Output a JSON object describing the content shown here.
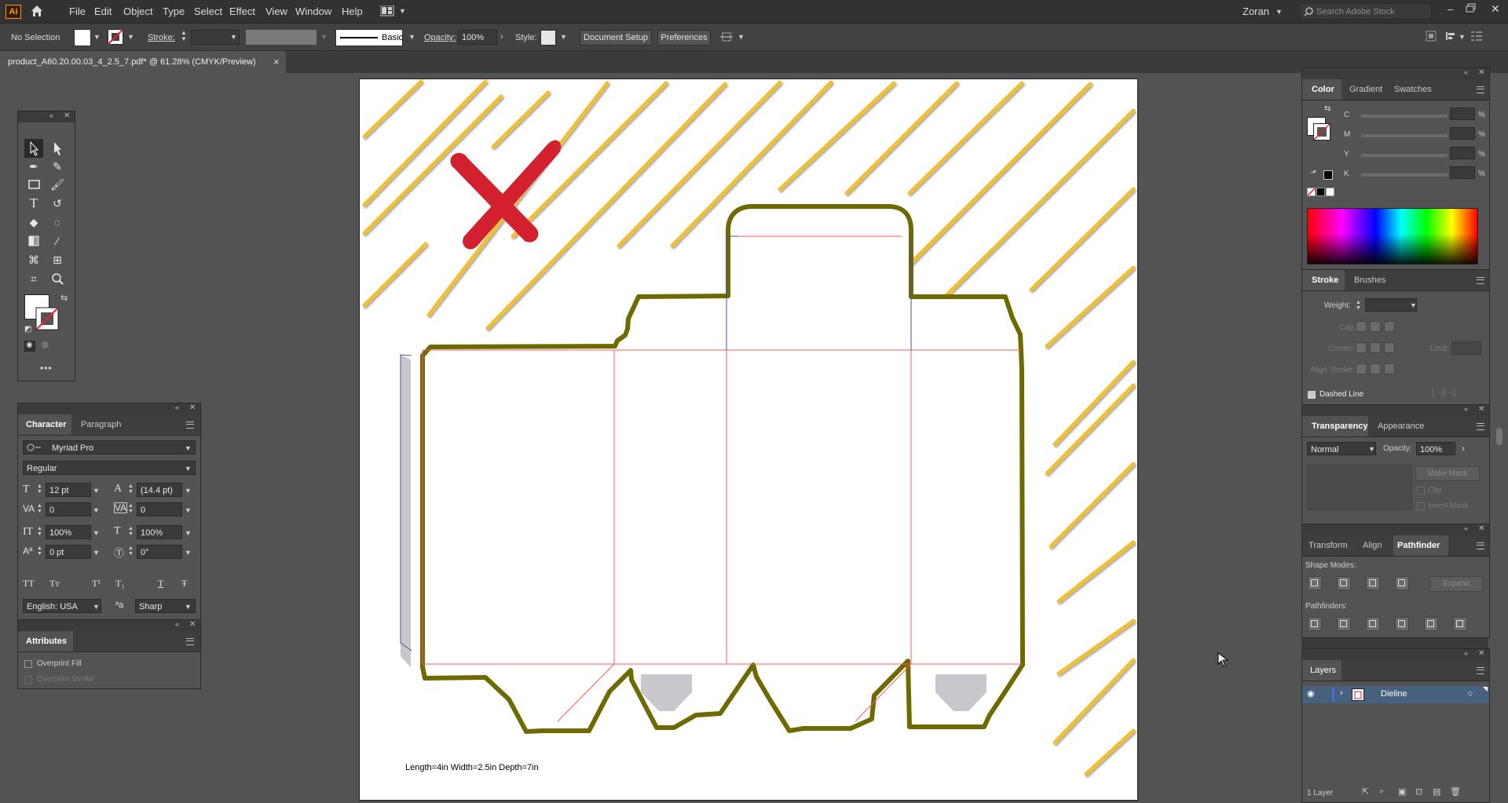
{
  "app": {
    "logo": "Ai",
    "user": "Zoran",
    "search_placeholder": "Search Adobe Stock"
  },
  "menu": [
    "File",
    "Edit",
    "Object",
    "Type",
    "Select",
    "Effect",
    "View",
    "Window",
    "Help"
  ],
  "control": {
    "selection": "No Selection",
    "stroke_label": "Stroke:",
    "brush": "Basic",
    "opacity_label": "Opacity:",
    "opacity": "100%",
    "style_label": "Style:",
    "doc_setup": "Document Setup",
    "preferences": "Preferences"
  },
  "document_tab": {
    "title": "product_A60.20.00.03_4_2.5_7.pdf* @ 61.28% (CMYK/Preview)",
    "close": "×"
  },
  "artboard": {
    "caption": "Length=4in Width=2.5in Depth=7in"
  },
  "character": {
    "tabs": [
      "Character",
      "Paragraph"
    ],
    "font": "Myriad Pro",
    "style": "Regular",
    "size": "12 pt",
    "leading": "(14.4 pt)",
    "kerning": "0",
    "tracking": "0",
    "vscale": "100%",
    "hscale": "100%",
    "baseline": "0 pt",
    "rotation": "0°",
    "case_buttons": [
      "TT",
      "Tт",
      "T¹",
      "T₁",
      "T",
      "Ŧ"
    ],
    "language": "English: USA",
    "aa_icon": "ªa",
    "antialias": "Sharp"
  },
  "attributes": {
    "title": "Attributes",
    "overprint_fill": "Overprint Fill",
    "overprint_stroke": "Overprint Stroke"
  },
  "color": {
    "tabs": [
      "Color",
      "Gradient",
      "Swatches"
    ],
    "channels": [
      "C",
      "M",
      "Y",
      "K"
    ],
    "pct": "%"
  },
  "stroke": {
    "tabs": [
      "Stroke",
      "Brushes"
    ],
    "weight": "Weight:",
    "cap": "Cap:",
    "corner": "Corner:",
    "limit": "Limit:",
    "align": "Align Stroke:",
    "dashed": "Dashed Line"
  },
  "transparency": {
    "tabs": [
      "Transparency",
      "Appearance"
    ],
    "mode": "Normal",
    "opacity_label": "Opacity:",
    "opacity": "100%",
    "make_mask": "Make Mask",
    "clip": "Clip",
    "invert": "Invert Mask"
  },
  "pathfinder": {
    "tabs": [
      "Transform",
      "Align",
      "Pathfinder"
    ],
    "shape_modes": "Shape Modes:",
    "pathfinders": "Pathfinders:",
    "expand": "Expand"
  },
  "layers": {
    "title": "Layers",
    "layer_name": "Dieline",
    "count": "1 Layer"
  },
  "colors": {
    "accent_red": "#d2202f",
    "stripe_yellow": "#f0c030",
    "dieline_olive": "#6f6a00",
    "crease_red": "#ff5a5a",
    "layer_blue": "#4a6fd0"
  }
}
